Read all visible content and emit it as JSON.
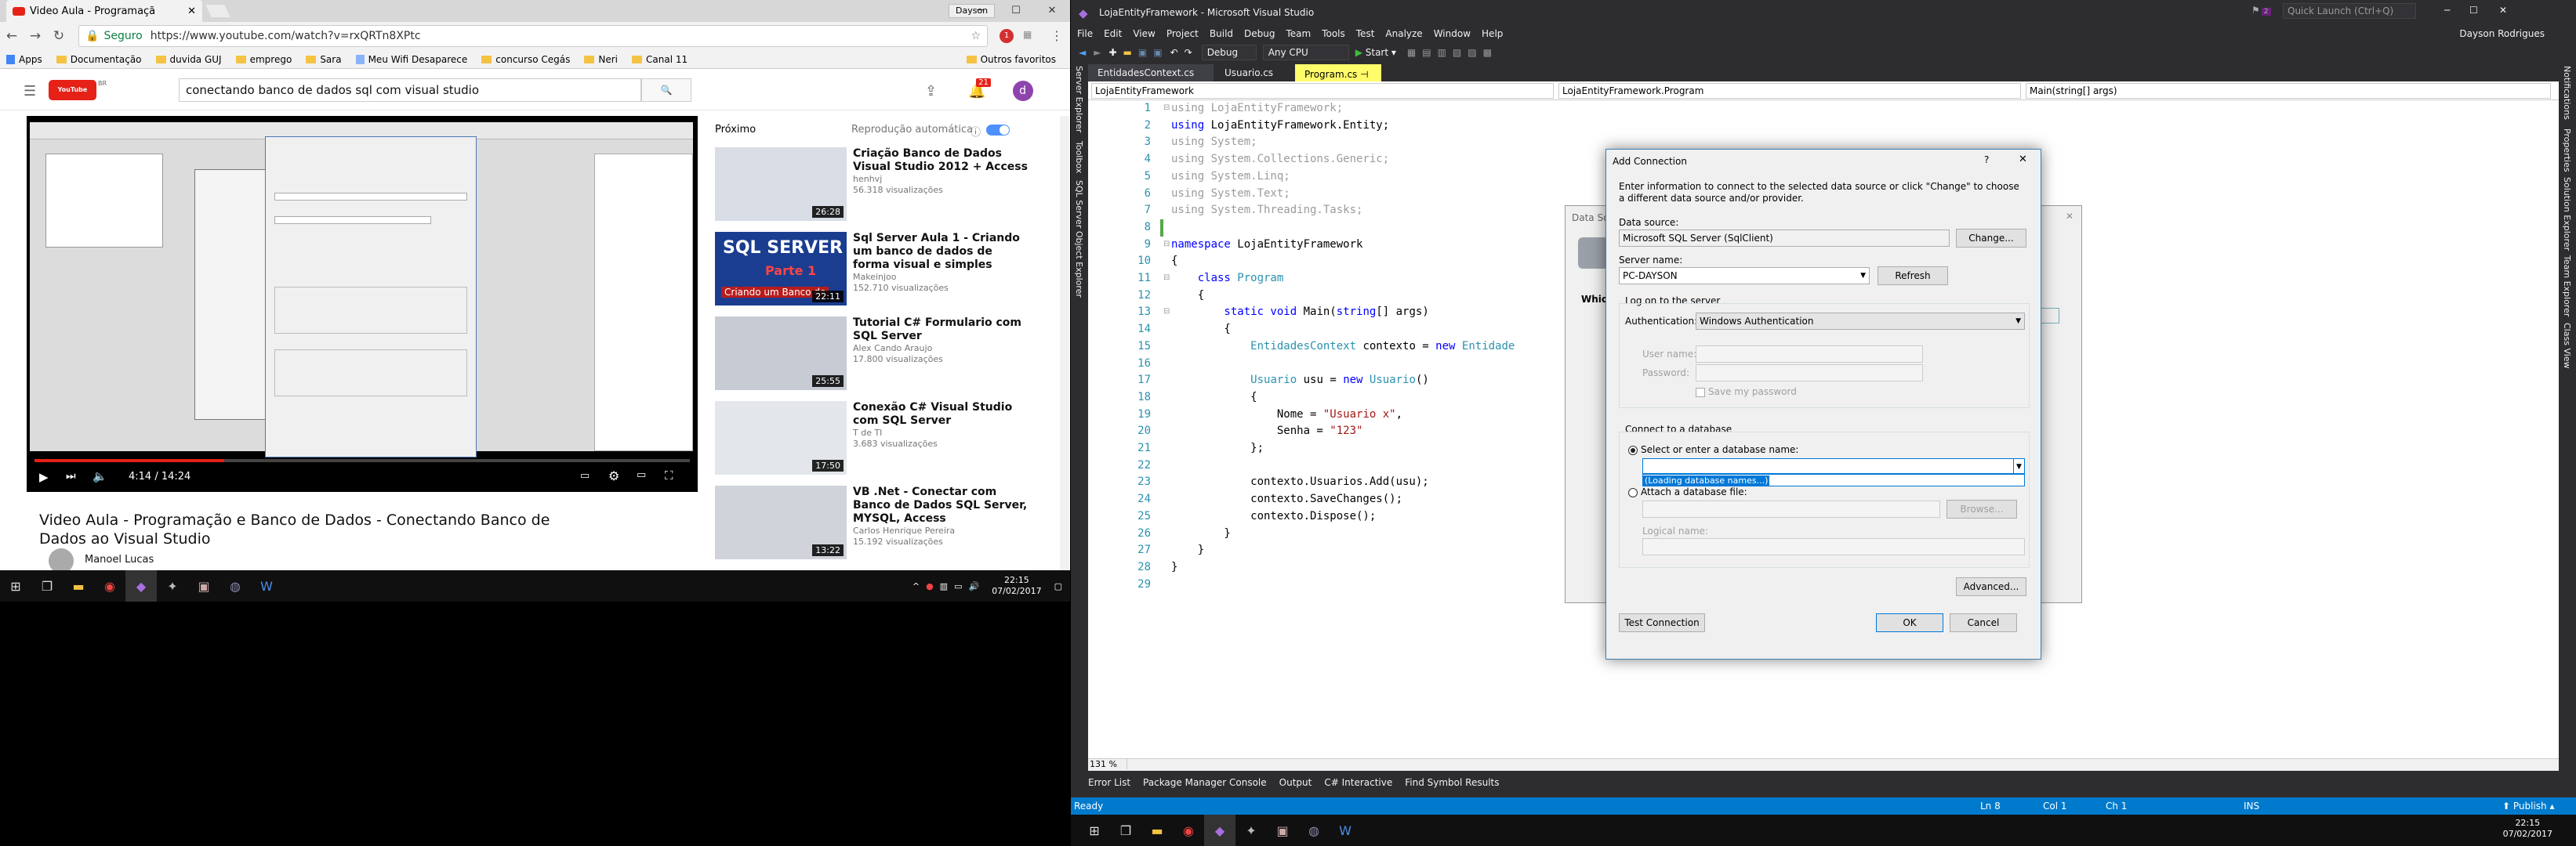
{
  "chrome": {
    "tab_title": "Video Aula - Programaçã",
    "profile_label": "Dayson",
    "secure_label": "Seguro",
    "url": "https://www.youtube.com/watch?v=rxQRTn8XPtc",
    "bookmarks": [
      "Apps",
      "Documentação",
      "duvida GUJ",
      "emprego",
      "Sara",
      "Meu Wifi Desaparece",
      "concurso Cegás",
      "Neri",
      "Canal 11"
    ],
    "other_bookmarks": "Outros favoritos",
    "ext_badge": "1",
    "bell_badge": "21",
    "user_initial": "d"
  },
  "youtube": {
    "logo_text": "YouTube",
    "logo_suffix": "BR",
    "search_query": "conectando banco de dados sql com visual studio",
    "video_title": "Video Aula - Programação e Banco de Dados - Conectando Banco de Dados ao Visual Studio",
    "channel": "Manoel Lucas",
    "time": "4:14 / 14:24",
    "progress": 0.29,
    "next_label": "Próximo",
    "autoplay_label": "Reprodução automática",
    "recommendations": [
      {
        "title": "Criação Banco de Dados Visual Studio 2012 + Access",
        "channel": "henhvj",
        "views": "56.318 visualizações",
        "duration": "26:28"
      },
      {
        "title": "Sql Server Aula 1 - Criando um banco de dados de forma visual e simples",
        "channel": "Makeinjoo",
        "views": "152.710 visualizações",
        "duration": "22:11"
      },
      {
        "title": "Tutorial C# Formulario com SQL Server",
        "channel": "Alex Cando Araujo",
        "views": "17.800 visualizações",
        "duration": "25:55"
      },
      {
        "title": "Conexão C# Visual Studio com SQL Server",
        "channel": "T de TI",
        "views": "3.683 visualizações",
        "duration": "17:50"
      },
      {
        "title": "VB .Net - Conectar com Banco de Dados SQL Server, MYSQL, Access",
        "channel": "Carlos Henrique Pereira",
        "views": "15.192 visualizações",
        "duration": "13:22"
      }
    ],
    "thumb_sql_text": "SQL SERVER",
    "thumb_sql_sub": "Parte 1",
    "thumb_sql_caption": "Criando um Banco de"
  },
  "taskbar": {
    "time": "22:15",
    "date": "07/02/2017"
  },
  "vs": {
    "title": "LojaEntityFramework - Microsoft Visual Studio",
    "quick_launch": "Quick Launch (Ctrl+Q)",
    "notif_badge": "2",
    "user": "Dayson Rodrigues",
    "menu": [
      "File",
      "Edit",
      "View",
      "Project",
      "Build",
      "Debug",
      "Team",
      "Tools",
      "Test",
      "Analyze",
      "Window",
      "Help"
    ],
    "config": "Debug",
    "platform": "Any CPU",
    "start": "Start",
    "doc_tabs": [
      "EntidadesContext.cs",
      "Usuario.cs",
      "Program.cs"
    ],
    "nav_project": "LojaEntityFramework",
    "nav_class": "LojaEntityFramework.Program",
    "nav_member": "Main(string[] args)",
    "left_tabs": [
      "Server Explorer",
      "Toolbox",
      "SQL Server Object Explorer"
    ],
    "right_tabs": [
      "Notifications",
      "Properties",
      "Solution Explorer",
      "Team Explorer",
      "Class View"
    ],
    "zoom": "131 %",
    "bottom_tabs": [
      "Error List",
      "Package Manager Console",
      "Output",
      "C# Interactive",
      "Find Symbol Results"
    ],
    "status": {
      "ready": "Ready",
      "ln": "Ln 8",
      "col": "Col 1",
      "ch": "Ch 1",
      "ins": "INS",
      "publish": "Publish"
    }
  },
  "code": {
    "line_numbers": [
      "1",
      "2",
      "3",
      "4",
      "5",
      "6",
      "7",
      "8",
      "9",
      "10",
      "11",
      "12",
      "13",
      "14",
      "15",
      "16",
      "17",
      "18",
      "19",
      "20",
      "21",
      "22",
      "23",
      "24",
      "25",
      "26",
      "27",
      "28",
      "29"
    ],
    "l1": "using LojaEntityFramework;",
    "l2a": "using",
    "l2b": " LojaEntityFramework.Entity;",
    "l3": "using System;",
    "l4": "using System.Collections.Generic;",
    "l5": "using System.Linq;",
    "l6": "using System.Text;",
    "l7": "using System.Threading.Tasks;",
    "l9a": "namespace",
    "l9b": " LojaEntityFramework",
    "l10": "{",
    "l11a": "    class",
    "l11b": " Program",
    "l12": "    {",
    "l13a": "        static void",
    "l13b": " Main(",
    "l13c": "string",
    "l13d": "[] args)",
    "l14": "        {",
    "l15a": "            ",
    "l15b": "EntidadesContext",
    "l15c": " contexto = ",
    "l15d": "new",
    "l15e": " ",
    "l15f": "Entidade",
    "l17a": "            ",
    "l17b": "Usuario",
    "l17c": " usu = ",
    "l17d": "new",
    "l17e": " ",
    "l17f": "Usuario",
    "l17g": "()",
    "l18": "            {",
    "l19a": "                Nome = ",
    "l19b": "\"Usuario x\"",
    "l19c": ",",
    "l20a": "                Senha = ",
    "l20b": "\"123\"",
    "l21": "            };",
    "l23": "            contexto.Usuarios.Add(usu);",
    "l24": "            contexto.SaveChanges();",
    "l25": "            contexto.Dispose();",
    "l26": "        }",
    "l27": "    }",
    "l28": "}"
  },
  "dialog": {
    "title": "Add Connection",
    "help": "?",
    "intro": "Enter information to connect to the selected data source or click \"Change\" to choose a different data source and/or provider.",
    "data_source_label": "Data source:",
    "data_source": "Microsoft SQL Server (SqlClient)",
    "change": "Change...",
    "server_label": "Server name:",
    "server": "PC-DAYSON",
    "refresh": "Refresh",
    "logon_title": "Log on to the server",
    "auth_label": "Authentication:",
    "auth": "Windows Authentication",
    "user_label": "User name:",
    "pass_label": "Password:",
    "save_pw": "Save my password",
    "connect_title": "Connect to a database",
    "select_db": "Select or enter a database name:",
    "loading": "(Loading database names...)",
    "attach": "Attach a database file:",
    "browse": "Browse...",
    "logical": "Logical name:",
    "advanced": "Advanced...",
    "test": "Test Connection",
    "ok": "OK",
    "cancel": "Cancel",
    "bg_title": "Data So",
    "bg_which": "Whic"
  }
}
